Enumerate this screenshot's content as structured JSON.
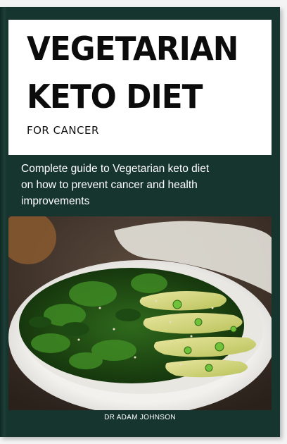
{
  "cover": {
    "title_line_1": "VEGETARIAN",
    "title_line_2": "KETO DIET",
    "subtitle": "FOR CANCER",
    "blurb_line_1": "Complete guide to Vegetarian keto diet",
    "blurb_line_2": "on how to prevent cancer and health",
    "blurb_line_3": "improvements",
    "author": "DR ADAM JOHNSON"
  },
  "colors": {
    "band": "#17352f",
    "title_panel": "#ffffff",
    "title_text": "#0c0c0c"
  }
}
